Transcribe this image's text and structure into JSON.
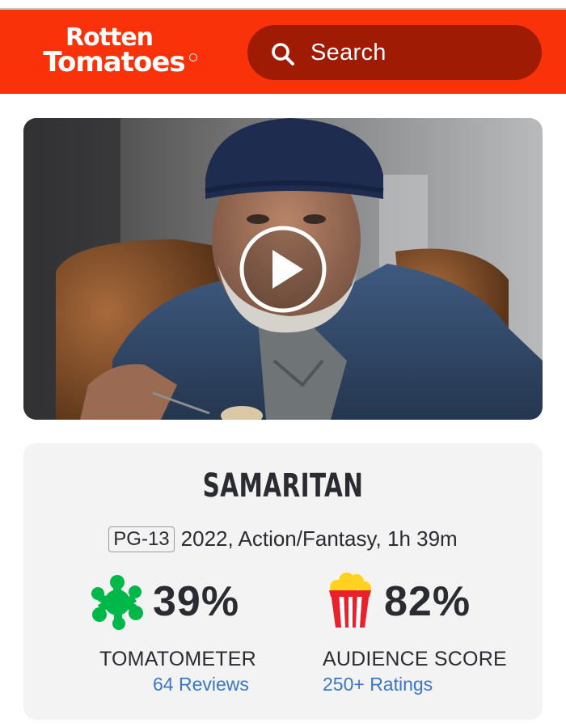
{
  "header": {
    "logo_line1": "Rotten",
    "logo_line2": "Tomatoes",
    "search_placeholder": "Search",
    "colors": {
      "brand_red": "#fa320a",
      "search_bg": "#a01b04"
    }
  },
  "video": {
    "play_icon": "play-icon"
  },
  "movie": {
    "title": "SAMARITAN",
    "rating": "PG-13",
    "details": "2022, Action/Fantasy, 1h 39m"
  },
  "scores": {
    "tomatometer": {
      "value": "39%",
      "label": "TOMATOMETER",
      "count_link": "64 Reviews",
      "icon": "green-splat-icon"
    },
    "audience": {
      "value": "82%",
      "label": "AUDIENCE SCORE",
      "count_link": "250+ Ratings",
      "icon": "popcorn-icon"
    },
    "colors": {
      "link_blue": "#3a76c4",
      "splat_green": "#00b84a"
    }
  }
}
